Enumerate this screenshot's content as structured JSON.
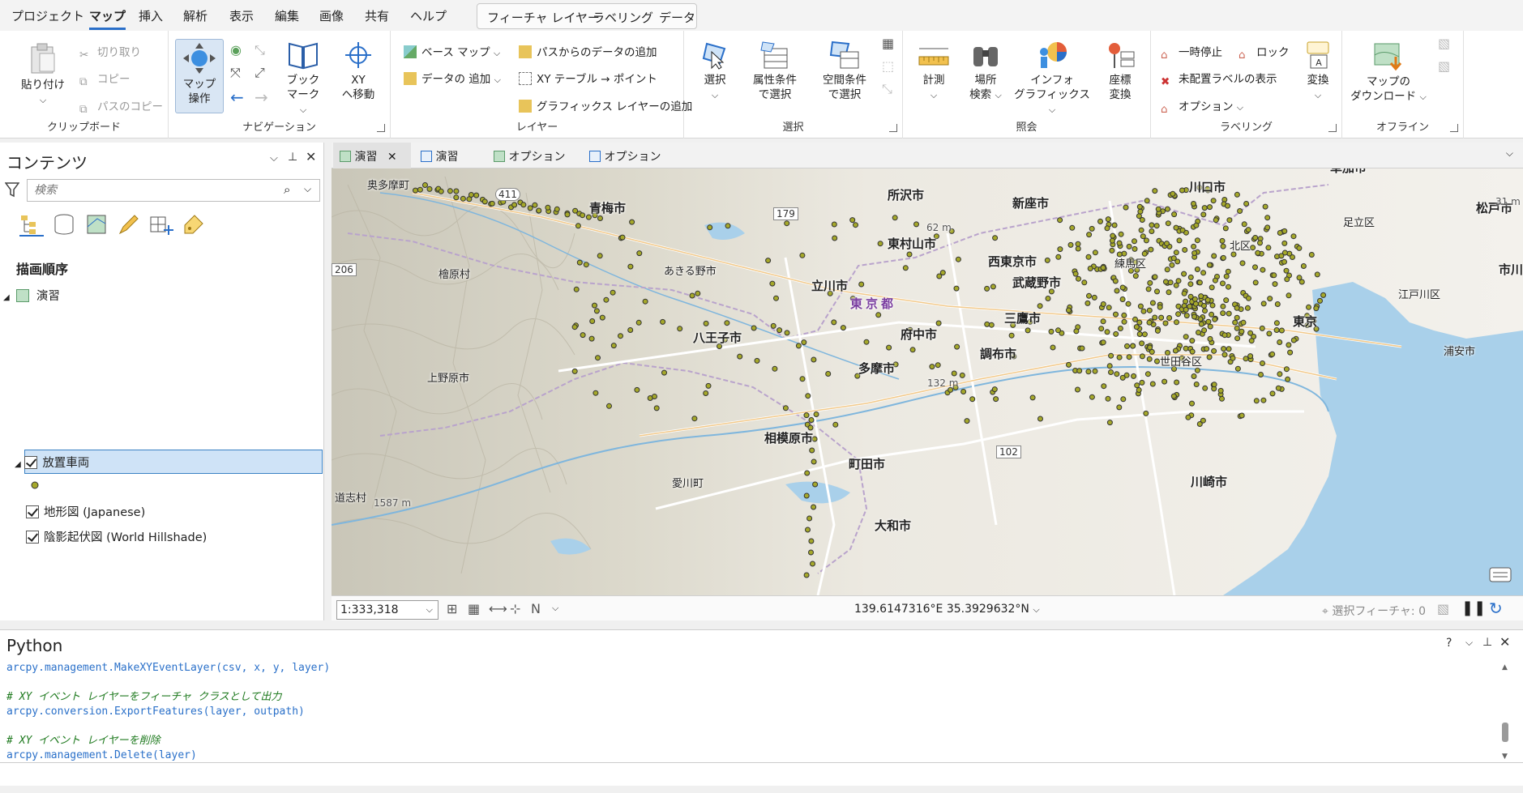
{
  "menu": {
    "tabs": [
      "プロジェクト",
      "マップ",
      "挿入",
      "解析",
      "表示",
      "編集",
      "画像",
      "共有",
      "ヘルプ"
    ],
    "active_tab": "マップ",
    "context_tabs": [
      "フィーチャ レイヤー",
      "ラベリング",
      "データ"
    ]
  },
  "ribbon": {
    "clipboard": {
      "label": "クリップボード",
      "paste": "貼り付け",
      "cut": "切り取り",
      "copy": "コピー",
      "copy_path": "パスのコピー"
    },
    "navigation": {
      "label": "ナビゲーション",
      "explore": "マップ\n操作",
      "bookmark": "ブック\nマーク",
      "goto_xy": "XY\nへ移動"
    },
    "layer": {
      "label": "レイヤー",
      "basemap": "ベース マップ",
      "add_data": "データの 追加",
      "add_from_path": "パスからのデータの追加",
      "xy_table": "XY テーブル → ポイント",
      "add_graphics": "グラフィックス レイヤーの追加"
    },
    "selection": {
      "label": "選択",
      "select": "選択",
      "select_by_attr": "属性条件\nで選択",
      "select_by_loc": "空間条件\nで選択"
    },
    "inquiry": {
      "label": "照会",
      "measure": "計測",
      "locate": "場所\n検索",
      "infographics": "インフォ\nグラフィックス",
      "convert_coords": "座標\n変換"
    },
    "labeling": {
      "label": "ラベリング",
      "pause": "一時停止",
      "lock": "ロック",
      "unplaced": "未配置ラベルの表示",
      "options": "オプション",
      "convert": "変換"
    },
    "offline": {
      "label": "オフライン",
      "download": "マップの\nダウンロード"
    }
  },
  "contents": {
    "title": "コンテンツ",
    "search_placeholder": "検索",
    "section": "描画順序",
    "map_name": "演習",
    "layers": [
      {
        "name": "放置車両",
        "checked": true,
        "selected": true
      },
      {
        "name": "地形図 (Japanese)",
        "checked": true,
        "selected": false
      },
      {
        "name": "陰影起伏図 (World Hillshade)",
        "checked": true,
        "selected": false
      }
    ]
  },
  "map_tabs": [
    {
      "label": "演習",
      "active": true,
      "closable": true
    },
    {
      "label": "演習",
      "active": false,
      "closable": false
    },
    {
      "label": "オプション",
      "active": false,
      "closable": false
    },
    {
      "label": "オプション",
      "active": false,
      "closable": false
    }
  ],
  "map": {
    "places": [
      {
        "name": "奥多摩町"
      },
      {
        "name": "青梅市"
      },
      {
        "name": "所沢市"
      },
      {
        "name": "新座市"
      },
      {
        "name": "川口市"
      },
      {
        "name": "草加市"
      },
      {
        "name": "松戸市"
      },
      {
        "name": "足立区"
      },
      {
        "name": "北区"
      },
      {
        "name": "東村山市"
      },
      {
        "name": "西東京市"
      },
      {
        "name": "練馬区"
      },
      {
        "name": "あきる野市"
      },
      {
        "name": "檜原村"
      },
      {
        "name": "立川市"
      },
      {
        "name": "東京都"
      },
      {
        "name": "武蔵野市"
      },
      {
        "name": "三鷹市"
      },
      {
        "name": "市川"
      },
      {
        "name": "江戸川区"
      },
      {
        "name": "東京"
      },
      {
        "name": "八王子市"
      },
      {
        "name": "府中市"
      },
      {
        "name": "調布市"
      },
      {
        "name": "世田谷区"
      },
      {
        "name": "多摩市"
      },
      {
        "name": "浦安市"
      },
      {
        "name": "上野原市"
      },
      {
        "name": "相模原市"
      },
      {
        "name": "町田市"
      },
      {
        "name": "愛川町"
      },
      {
        "name": "川崎市"
      },
      {
        "name": "道志村"
      },
      {
        "name": "大和市"
      }
    ],
    "elevations": [
      "62 m",
      "132 m",
      "1587 m",
      "31 m"
    ],
    "road_numbers": [
      "411",
      "179",
      "206",
      "102"
    ]
  },
  "status": {
    "scale": "1:333,318",
    "coords": "139.6147316°E 35.3929632°N",
    "selected_features": "選択フィーチャ: 0"
  },
  "python": {
    "title": "Python",
    "lines": [
      {
        "text": "arcpy.management.MakeXYEventLayer(csv, x, y, layer)",
        "kind": "call"
      },
      {
        "text": "",
        "kind": "blank"
      },
      {
        "text": "# XY イベント レイヤーをフィーチャ クラスとして出力",
        "kind": "comment"
      },
      {
        "text": "arcpy.conversion.ExportFeatures(layer, outpath)",
        "kind": "call"
      },
      {
        "text": "",
        "kind": "blank"
      },
      {
        "text": "# XY イベント レイヤーを削除",
        "kind": "comment"
      },
      {
        "text": "arcpy.management.Delete(layer)",
        "kind": "call"
      }
    ]
  },
  "colors": {
    "accent": "#2a6fc9",
    "point_fill": "#a5a82a",
    "point_stroke": "#333333",
    "water": "#a9d0ea",
    "selection": "#cfe3f7"
  }
}
